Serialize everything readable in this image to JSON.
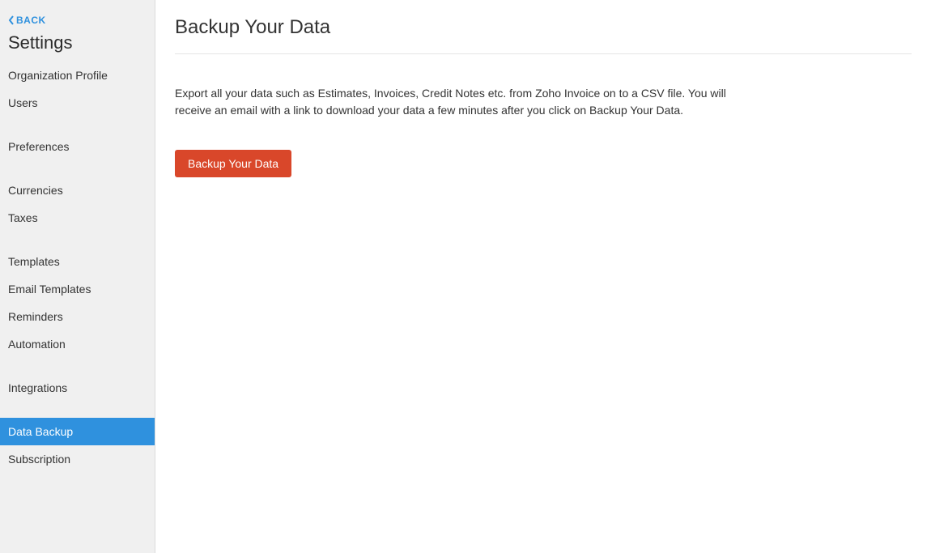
{
  "sidebar": {
    "back_label": "BACK",
    "title": "Settings",
    "items": [
      {
        "label": "Organization Profile",
        "active": false
      },
      {
        "label": "Users",
        "active": false
      },
      {
        "label": "Preferences",
        "active": false
      },
      {
        "label": "Currencies",
        "active": false
      },
      {
        "label": "Taxes",
        "active": false
      },
      {
        "label": "Templates",
        "active": false
      },
      {
        "label": "Email Templates",
        "active": false
      },
      {
        "label": "Reminders",
        "active": false
      },
      {
        "label": "Automation",
        "active": false
      },
      {
        "label": "Integrations",
        "active": false
      },
      {
        "label": "Data Backup",
        "active": true
      },
      {
        "label": "Subscription",
        "active": false
      }
    ]
  },
  "main": {
    "title": "Backup Your Data",
    "description": "Export all your data such as Estimates, Invoices, Credit Notes etc. from Zoho Invoice on to a CSV file. You will receive an email with a link to download your data a few minutes after you click on Backup Your Data.",
    "button_label": "Backup Your Data"
  }
}
